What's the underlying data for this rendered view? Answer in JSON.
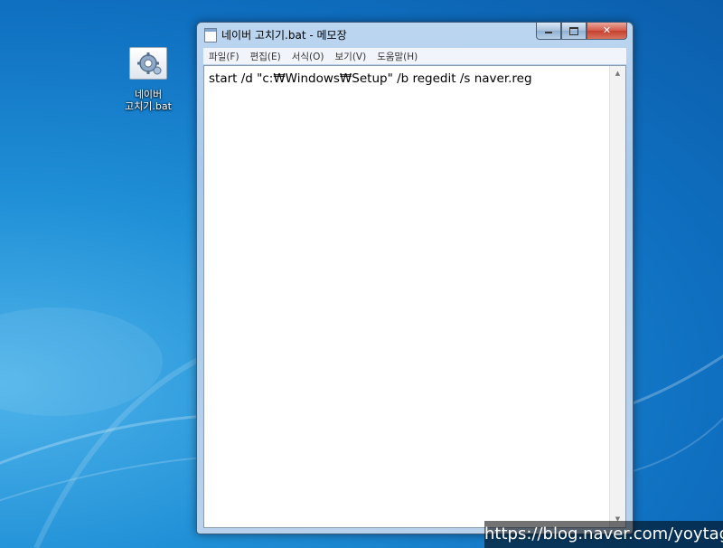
{
  "desktop": {
    "icon": {
      "label_line1": "네이버",
      "label_line2": "고치기.bat",
      "icon_name": "batch-file-gear-icon"
    }
  },
  "window": {
    "title": "네이버 고치기.bat - 메모장",
    "title_icon": "notepad-icon",
    "caption": {
      "minimize_icon": "minimize-icon",
      "maximize_icon": "maximize-icon",
      "close_label": "✕"
    },
    "menu": [
      {
        "label": "파일(F)"
      },
      {
        "label": "편집(E)"
      },
      {
        "label": "서식(O)"
      },
      {
        "label": "보기(V)"
      },
      {
        "label": "도움말(H)"
      }
    ],
    "content": "start /d \"c:₩Windows₩Setup\" /b regedit /s naver.reg",
    "scrollbar": {
      "up_arrow": "▲",
      "down_arrow": "▼"
    }
  },
  "watermark": "https://blog.naver.com/yoytag",
  "colors": {
    "desktop_blue": "#1f8fd6",
    "window_frame": "#b8d2ec",
    "close_red": "#c4402e"
  }
}
